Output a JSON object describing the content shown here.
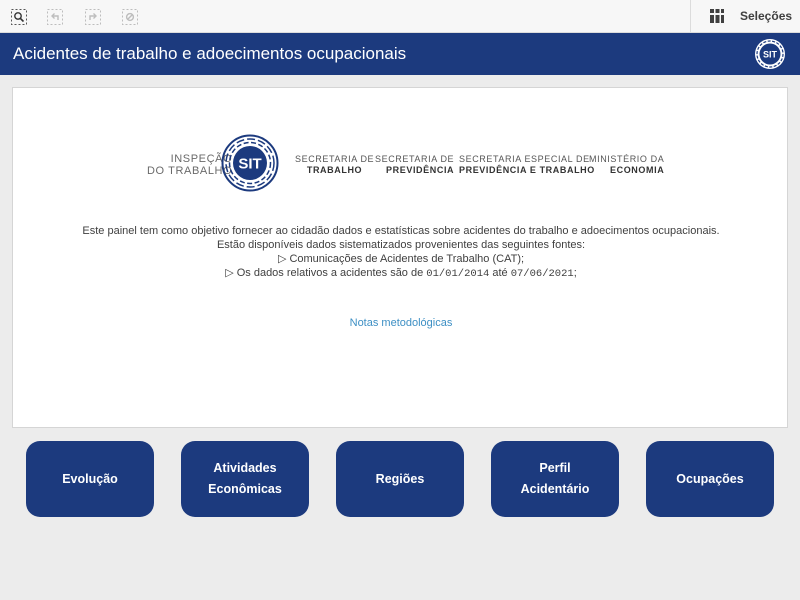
{
  "toolbar": {
    "icons": [
      "search-icon",
      "step-back-icon",
      "step-forward-icon",
      "clear-selections-icon"
    ],
    "selections_label": "Seleções"
  },
  "header": {
    "title": "Acidentes de trabalho e adoecimentos ocupacionais",
    "badge_text": "SIT",
    "color": "#1c3a7e"
  },
  "logos": {
    "inspecao_line1": "INSPEÇÃO",
    "inspecao_line2": "DO TRABALHO",
    "seal_text": "SIT",
    "orgs": [
      {
        "line1": "SECRETARIA DE",
        "line2": "TRABALHO"
      },
      {
        "line1": "SECRETARIA DE",
        "line2": "PREVIDÊNCIA"
      },
      {
        "line1": "SECRETARIA ESPECIAL DE",
        "line2": "PREVIDÊNCIA E TRABALHO"
      },
      {
        "line1": "MINISTÉRIO DA",
        "line2": "ECONOMIA"
      }
    ]
  },
  "intro": {
    "line1": "Este painel tem como objetivo fornecer ao cidadão dados e estatísticas sobre acidentes do trabalho e adoecimentos ocupacionais.",
    "line2": "Estão disponíveis dados sistematizados provenientes das seguintes fontes:",
    "line3": "▷ Comunicações de Acidentes de Trabalho (CAT);",
    "line4_prefix": "▷ Os dados relativos a acidentes são de ",
    "date_start": "01/01/2014",
    "line4_mid": " até ",
    "date_end": "07/06/2021",
    "line4_suffix": ";"
  },
  "notes_link": "Notas metodológicas",
  "nav": {
    "evolucao": "Evolução",
    "atividades_1": "Atividades",
    "atividades_2": "Econômicas",
    "regioes": "Regiões",
    "perfil_1": "Perfil",
    "perfil_2": "Acidentário",
    "ocupacoes": "Ocupações"
  },
  "colors": {
    "brand": "#1c3a7e",
    "link": "#3d8fc4",
    "background": "#ececec"
  }
}
